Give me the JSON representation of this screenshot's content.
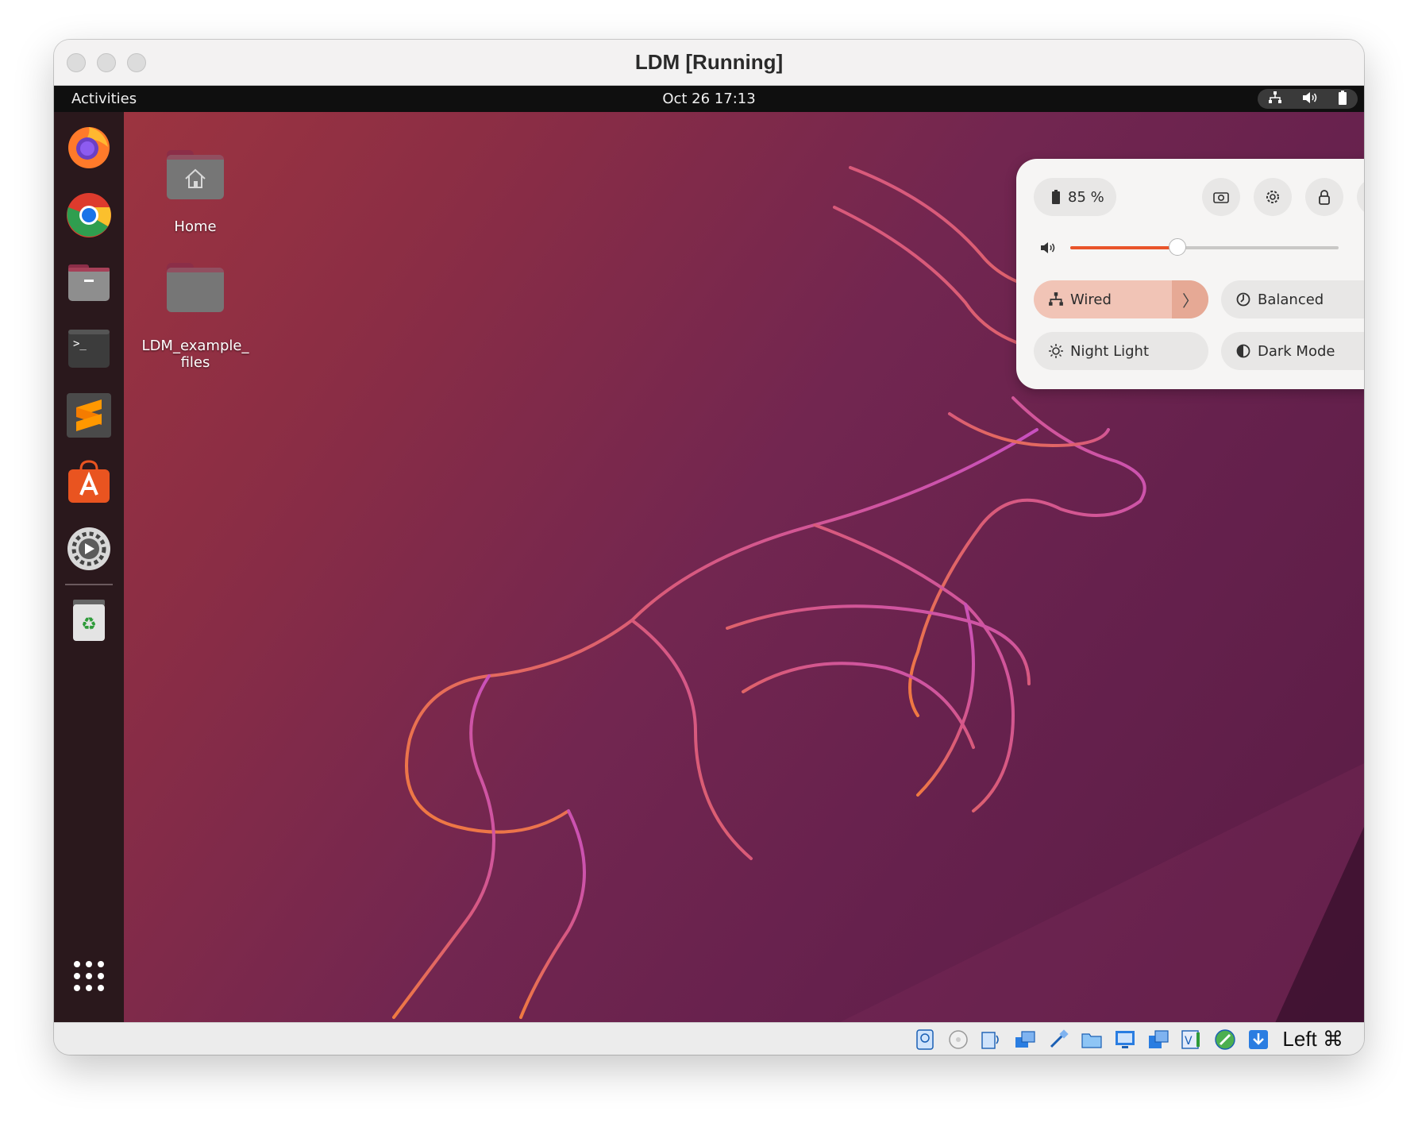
{
  "window": {
    "title": "LDM [Running]"
  },
  "topbar": {
    "activities": "Activities",
    "clock": "Oct 26  17:13",
    "tray_icons": [
      "network-icon",
      "volume-icon",
      "battery-icon"
    ]
  },
  "dock": {
    "items": [
      {
        "name": "firefox"
      },
      {
        "name": "chrome"
      },
      {
        "name": "files"
      },
      {
        "name": "terminal"
      },
      {
        "name": "sublime-text"
      },
      {
        "name": "app-center"
      },
      {
        "name": "settings"
      },
      {
        "name": "trash"
      },
      {
        "name": "show-apps"
      }
    ]
  },
  "desktop": {
    "icons": [
      {
        "label": "Home"
      },
      {
        "label": "LDM_example_\nfiles"
      }
    ]
  },
  "quick_settings": {
    "battery_label": "85 %",
    "volume_level": 0.4,
    "tiles": {
      "wired": "Wired",
      "balanced": "Balanced",
      "night_light": "Night Light",
      "dark_mode": "Dark Mode"
    },
    "accent_color": "#e9542a",
    "active_tile_color": "#f1c4b6"
  },
  "statusbar": {
    "host_key": "Left ⌘",
    "icons": [
      "hard-disk-icon",
      "optical-disk-icon",
      "audio-icon",
      "network-icon",
      "usb-icon",
      "shared-folder-icon",
      "display-icon",
      "capture-icon",
      "recording-icon",
      "mouse-integration-icon",
      "download-icon"
    ]
  }
}
